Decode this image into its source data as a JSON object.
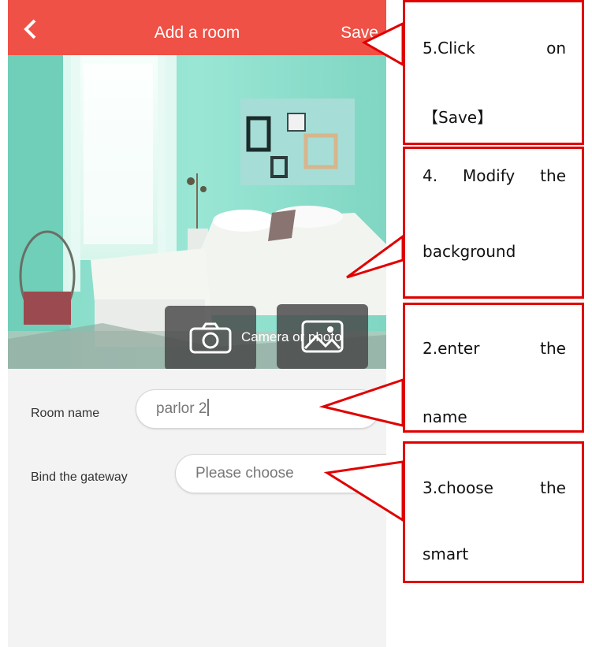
{
  "app": {
    "title": "Add a room",
    "save_label": "Save",
    "hero_caption": "Camera or photo"
  },
  "form": {
    "room_name_label": "Room name",
    "room_name_value": "parlor 2",
    "gateway_label": "Bind the gateway",
    "gateway_placeholder": "Please choose"
  },
  "callouts": {
    "save": {
      "line1": "5.Click on",
      "line2": "【Save】"
    },
    "background": {
      "line1": "4. Modify the",
      "line2": "background"
    },
    "name": {
      "line1": "2.enter the",
      "line2": "name"
    },
    "gateway": {
      "line1": "3.choose the",
      "line2": "smart"
    }
  },
  "colors": {
    "topbar": "#ef5146",
    "callout_border": "#e00000",
    "room_wall": "#8fe0cc"
  },
  "icons": [
    "back-chevron-icon",
    "camera-icon",
    "gallery-icon"
  ]
}
